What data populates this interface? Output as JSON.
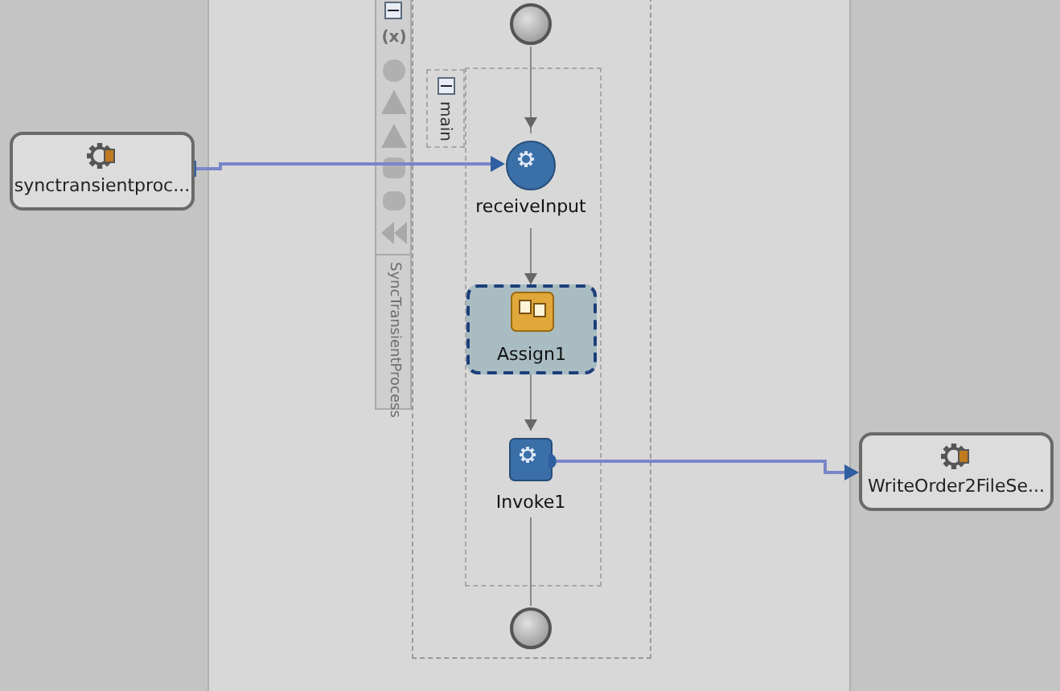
{
  "partner_links": [
    {
      "label": "synctransientproc..."
    },
    {
      "label": "WriteOrder2FileSe..."
    }
  ],
  "scope": {
    "name": "SyncTransientProcess",
    "expanded": true,
    "variables_symbol": "(x)"
  },
  "sequence": {
    "label": "main",
    "expanded": true
  },
  "activities": [
    {
      "kind": "start"
    },
    {
      "kind": "receive",
      "label": "receiveInput",
      "selected": false
    },
    {
      "kind": "assign",
      "label": "Assign1",
      "selected": true
    },
    {
      "kind": "invoke",
      "label": "Invoke1",
      "selected": false
    },
    {
      "kind": "end"
    }
  ]
}
